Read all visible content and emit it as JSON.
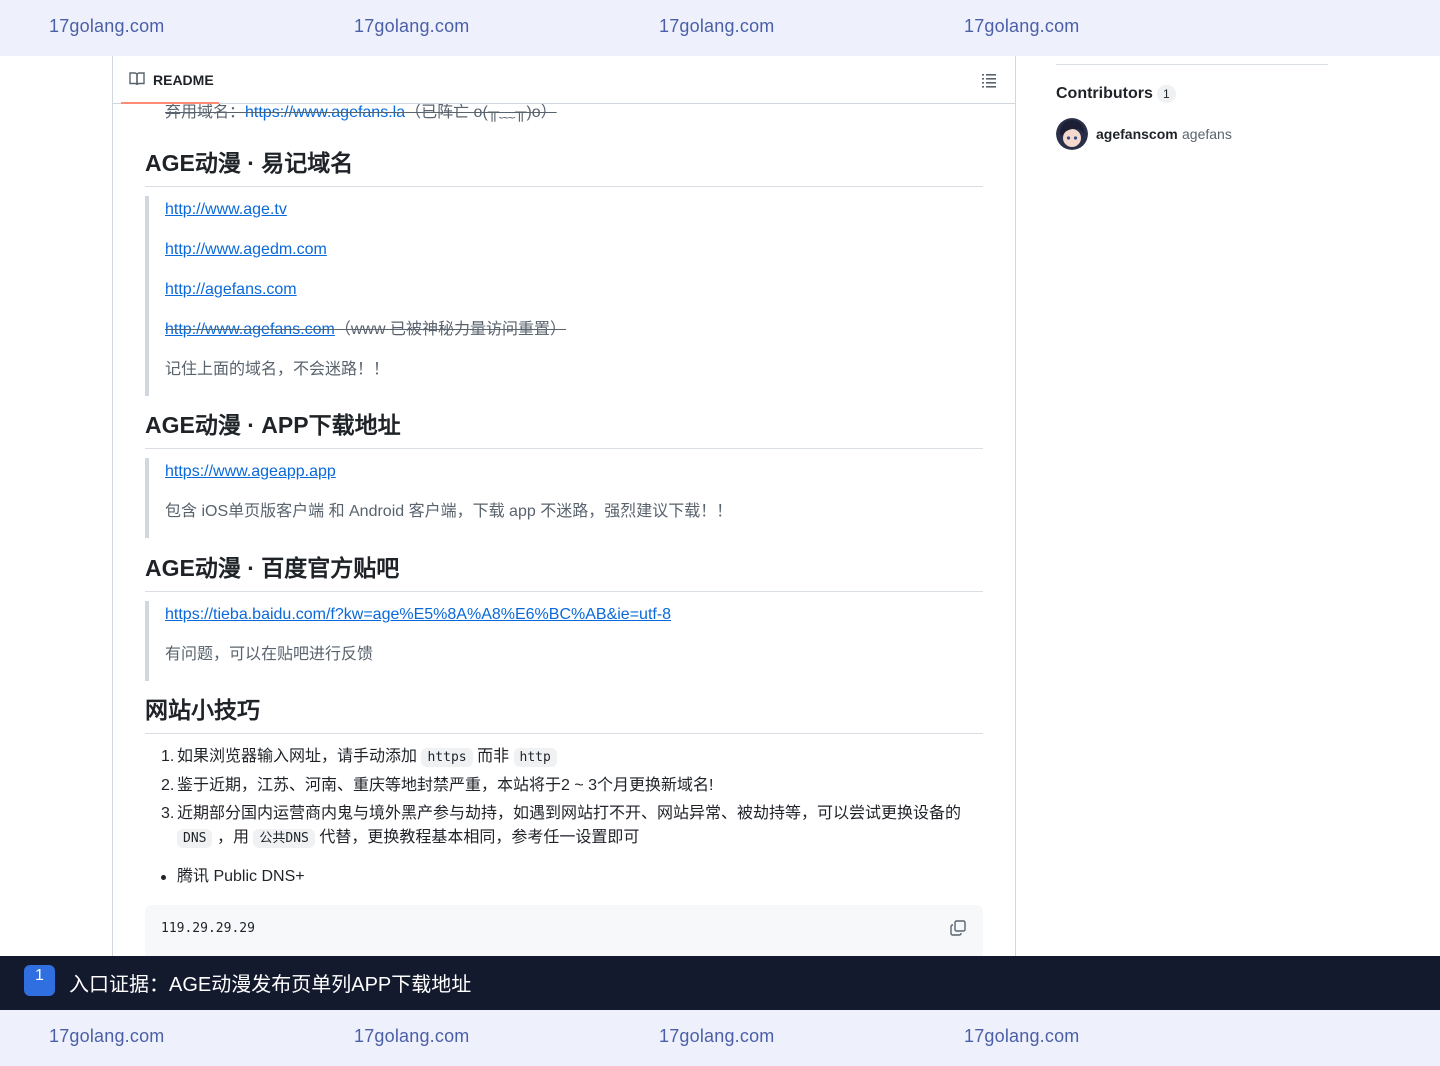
{
  "watermark": {
    "top": [
      "17golang.com",
      "17golang.com",
      "17golang.com",
      "17golang.com"
    ],
    "bottom": [
      "17golang.com",
      "17golang.com",
      "17golang.com",
      "17golang.com"
    ]
  },
  "readme": {
    "header_title": "README",
    "cut_line": {
      "prefix": "弃用域名：",
      "link": "https://www.agefans.la",
      "suffix": "（已阵亡 o(╥﹏╥)o）"
    },
    "sections": [
      {
        "heading": "AGE动漫 · 易记域名",
        "links": [
          "http://www.age.tv",
          "http://www.agedm.com",
          "http://agefans.com"
        ],
        "strike_link": "http://www.agefans.com",
        "strike_note": "（www 已被神秘力量访问重置）",
        "note": "记住上面的域名，不会迷路！！"
      },
      {
        "heading": "AGE动漫 · APP下载地址",
        "link": "https://www.ageapp.app",
        "note": "包含 iOS单页版客户端 和 Android 客户端，下载 app 不迷路，强烈建议下载！！"
      },
      {
        "heading": "AGE动漫 · 百度官方贴吧",
        "link": "https://tieba.baidu.com/f?kw=age%E5%8A%A8%E6%BC%AB&ie=utf-8",
        "note": "有问题，可以在贴吧进行反馈"
      },
      {
        "heading": "网站小技巧",
        "tips": [
          {
            "num": "1.",
            "a": "如果浏览器输入网址，请手动添加",
            "code1": "https",
            "b": "而非",
            "code2": "http"
          },
          {
            "num": "2.",
            "text": "鉴于近期，江苏、河南、重庆等地封禁严重，本站将于2 ~ 3个月更换新域名!"
          },
          {
            "num": "3.",
            "a": "近期部分国内运营商内鬼与境外黑产参与劫持，如遇到网站打不开、网站异常、被劫持等，可以尝试更换设备的",
            "code1": "DNS",
            "b": "，用",
            "code2": "公共DNS",
            "c": "代替，更换教程基本相同，参考任一设置即可"
          }
        ],
        "bullet": "腾讯 Public DNS+",
        "code": "119.29.29.29"
      }
    ]
  },
  "sidebar": {
    "contributors_title": "Contributors",
    "contributors_count": "1",
    "user_login": "agefanscom",
    "user_name": "agefans"
  },
  "caption": {
    "badge": "1",
    "text": "入口证据：AGE动漫发布页单列APP下载地址"
  },
  "colors": {
    "link": "#0969da",
    "caption_bg": "#141a2e",
    "badge": "#2f6fe0",
    "tab_underline": "#fd8c73"
  }
}
